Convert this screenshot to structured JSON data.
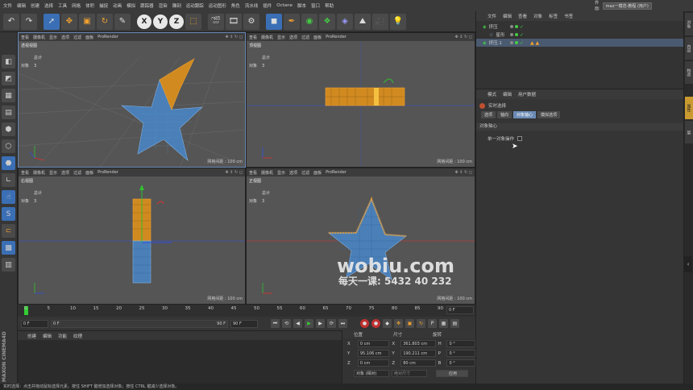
{
  "menu": [
    "文件",
    "编辑",
    "创建",
    "选择",
    "工具",
    "网格",
    "体积",
    "捕捉",
    "动画",
    "模拟",
    "跟踪器",
    "渲染",
    "雕刻",
    "运动跟踪",
    "运动图形",
    "角色",
    "流水线",
    "插件",
    "Octane",
    "脚本",
    "窗口",
    "帮助"
  ],
  "layout": {
    "label": "界面:",
    "value": "max一模范-教程 (用户)"
  },
  "toolbar": {
    "undo": "↶",
    "axis_x": "X",
    "axis_y": "Y",
    "axis_z": "Z"
  },
  "viewports": [
    {
      "menu": [
        "查看",
        "摄像机",
        "显示",
        "选项",
        "过滤",
        "面板",
        "ProRender"
      ],
      "name": "透视视图",
      "stats_label_1": "总计",
      "stats_label_2": "对象",
      "stats_value": "3",
      "grid": "网格间距 : 100 cm"
    },
    {
      "menu": [
        "查看",
        "摄像机",
        "显示",
        "选项",
        "过滤",
        "面板",
        "ProRender"
      ],
      "name": "顶视图",
      "stats_label_1": "总计",
      "stats_label_2": "对象",
      "stats_value": "3",
      "grid": "网格间距 : 100 cm"
    },
    {
      "menu": [
        "查看",
        "摄像机",
        "显示",
        "选项",
        "过滤",
        "面板",
        "ProRender"
      ],
      "name": "右视图",
      "stats_label_1": "总计",
      "stats_label_2": "对象",
      "stats_value": "3",
      "grid": "网格间距 : 100 cm"
    },
    {
      "menu": [
        "查看",
        "摄像机",
        "显示",
        "选项",
        "过滤",
        "面板",
        "ProRender"
      ],
      "name": "正视图",
      "stats_label_1": "总计",
      "stats_label_2": "对象",
      "stats_value": "3",
      "grid": "网格间距 : 100 cm"
    }
  ],
  "timeline": {
    "ticks": [
      "0",
      "5",
      "10",
      "15",
      "20",
      "25",
      "30",
      "35",
      "40",
      "45",
      "50",
      "55",
      "60",
      "65",
      "70",
      "75",
      "80",
      "85",
      "90"
    ],
    "end_field": "0 F"
  },
  "playbar": {
    "start": "0 F",
    "current": "0 F",
    "range_end": "90 F",
    "end": "90 F"
  },
  "materials": {
    "menu": [
      "创建",
      "编辑",
      "功能",
      "纹理"
    ]
  },
  "coords": {
    "headers": [
      "位置",
      "尺寸",
      "旋转"
    ],
    "rows": [
      {
        "axis": "X",
        "pos": "0 cm",
        "size_axis": "X",
        "size": "361.803 cm",
        "rot_axis": "H",
        "rot": "0 °"
      },
      {
        "axis": "Y",
        "pos": "95.106 cm",
        "size_axis": "Y",
        "size": "190.211 cm",
        "rot_axis": "P",
        "rot": "0 °"
      },
      {
        "axis": "Z",
        "pos": "0 cm",
        "size_axis": "Z",
        "size": "80 cm",
        "rot_axis": "B",
        "rot": "0 °"
      }
    ],
    "mode": "对象 (相对)",
    "size_mode": "绝对尺寸",
    "apply": "应用"
  },
  "object_manager": {
    "menu": [
      "文件",
      "编辑",
      "查看",
      "对象",
      "标签",
      "书签"
    ],
    "items": [
      {
        "name": "挤压",
        "indent": 0
      },
      {
        "name": "星形",
        "indent": 1
      },
      {
        "name": "挤压.1",
        "indent": 0
      }
    ]
  },
  "attributes": {
    "menu": [
      "模式",
      "编辑",
      "用户数据"
    ],
    "title": "实时选择",
    "tabs": [
      "选项",
      "轴向",
      "对象轴心",
      "模拟选项"
    ],
    "active_tab": 2,
    "section": "对象轴心",
    "option": "单一对象操作"
  },
  "status": "实时选择：点击并拖动鼠标选择元素。按住 SHIFT 键增加选择对象；按住 CTRL 键减少选择对象。",
  "watermark": {
    "brand": "wobiu.com",
    "sub": "每天一课: 5432 40 232"
  },
  "side_logo": "MAXON CINEMA4D",
  "colors": {
    "selection": "#f0a030",
    "mesh": "#5b9bd5",
    "axis_x": "#e03030",
    "axis_y": "#30c030",
    "axis_z": "#3050e0"
  }
}
